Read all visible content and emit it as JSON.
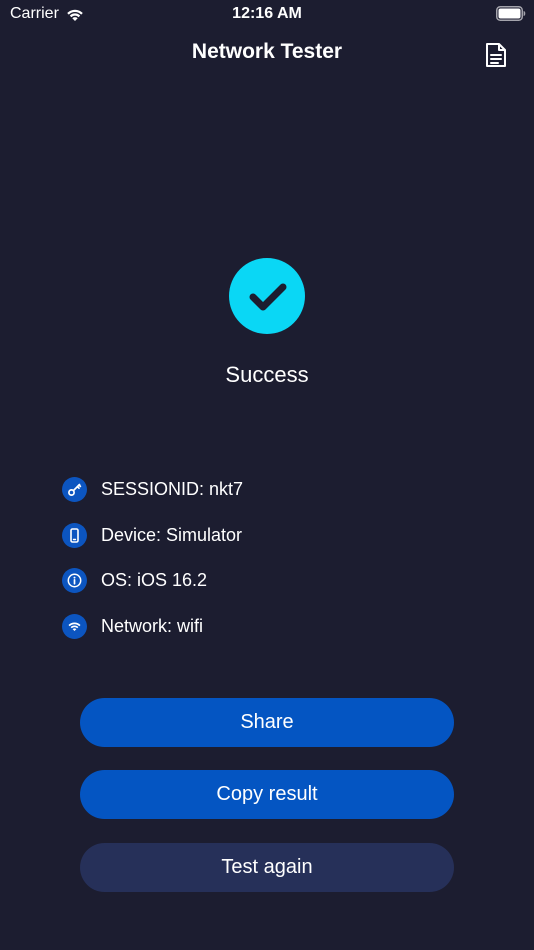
{
  "status_bar": {
    "carrier": "Carrier",
    "time": "12:16 AM"
  },
  "nav": {
    "title": "Network Tester",
    "doc_icon": "document-icon"
  },
  "result": {
    "status": "Success",
    "icon": "checkmark-icon",
    "accent_color": "#0ad7f5"
  },
  "info": [
    {
      "icon": "key-icon",
      "text": "SESSIONID: nkt7"
    },
    {
      "icon": "phone-icon",
      "text": "Device: Simulator"
    },
    {
      "icon": "info-icon",
      "text": "OS: iOS 16.2"
    },
    {
      "icon": "wifi-icon",
      "text": "Network: wifi"
    }
  ],
  "buttons": {
    "share": "Share",
    "copy": "Copy result",
    "again": "Test again"
  },
  "colors": {
    "background": "#1c1d30",
    "primary_button": "#0455c2",
    "secondary_button": "#263059",
    "icon_badge": "#0c55c0"
  }
}
